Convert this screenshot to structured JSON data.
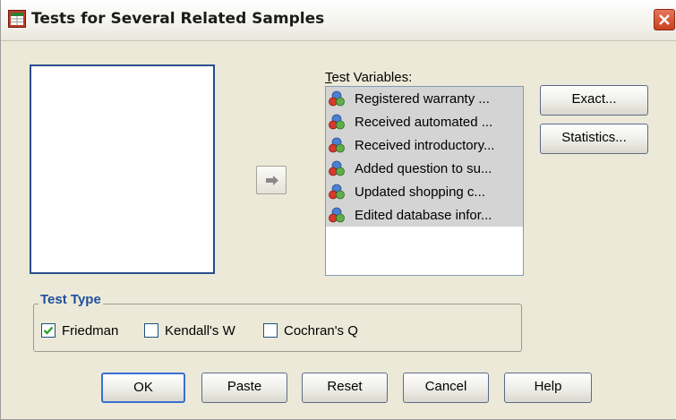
{
  "window": {
    "title": "Tests for Several Related Samples"
  },
  "test_variables": {
    "label": "Test Variables:",
    "items": [
      "Registered warranty ...",
      "Received automated ...",
      "Received introductory...",
      "Added question to su...",
      "Updated shopping c...",
      "Edited database infor..."
    ]
  },
  "side_buttons": {
    "exact": "Exact...",
    "statistics": "Statistics..."
  },
  "test_type": {
    "title": "Test Type",
    "options": [
      {
        "label": "Friedman",
        "checked": true
      },
      {
        "label": "Kendall's W",
        "checked": false
      },
      {
        "label": "Cochran's Q",
        "checked": false
      }
    ]
  },
  "footer_buttons": {
    "ok": "OK",
    "paste": "Paste",
    "reset": "Reset",
    "cancel": "Cancel",
    "help": "Help"
  },
  "icons": {
    "app": "spss-dialog-icon",
    "variable": "scale-variable-icon",
    "move": "arrow-right-icon",
    "close": "close-icon"
  }
}
